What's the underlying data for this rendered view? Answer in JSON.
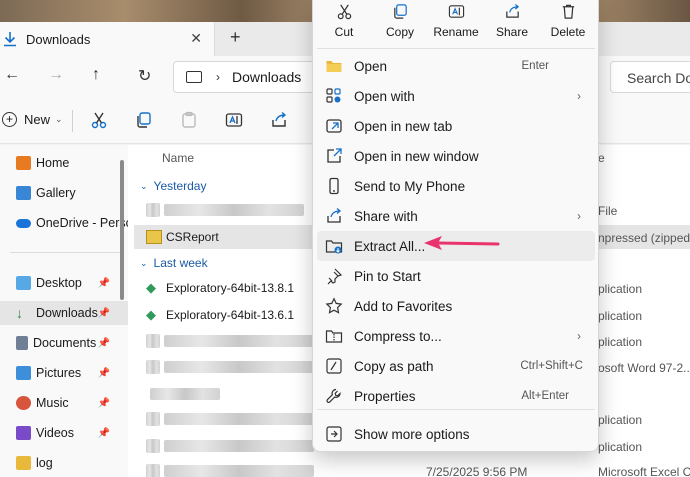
{
  "window": {
    "tab_title": "Downloads"
  },
  "address": {
    "segment": "Downloads"
  },
  "search": {
    "placeholder": "Search Dow"
  },
  "toolbar": {
    "new_label": "New"
  },
  "sidebar": {
    "items": [
      {
        "label": "Home",
        "color": "#e87b22",
        "pinned": false
      },
      {
        "label": "Gallery",
        "color": "#3a86d6",
        "pinned": false
      },
      {
        "label": "OneDrive - Perso",
        "color": "#1a73d8",
        "pinned": false
      },
      {
        "label": "Desktop",
        "color": "#57a9e6",
        "pinned": true
      },
      {
        "label": "Downloads",
        "color": "#2f8a4b",
        "pinned": true
      },
      {
        "label": "Documents",
        "color": "#6f7f95",
        "pinned": true
      },
      {
        "label": "Pictures",
        "color": "#3d8fd9",
        "pinned": true
      },
      {
        "label": "Music",
        "color": "#d8553d",
        "pinned": true
      },
      {
        "label": "Videos",
        "color": "#7a4bc8",
        "pinned": true
      },
      {
        "label": "log",
        "color": "#e8b93a",
        "pinned": false
      }
    ]
  },
  "content": {
    "column_name": "Name",
    "group_yesterday": "Yesterday",
    "group_last_week": "Last week",
    "files": {
      "csreport": "CSReport",
      "exploratory1": "Exploratory-64bit-13.8.1",
      "exploratory2": "Exploratory-64bit-13.6.1"
    },
    "type_col": {
      "r1": "File",
      "r2": "npressed (zipped)...",
      "r3": "plication",
      "r4": "plication",
      "r5": "plication",
      "r6": "osoft Word 97-2...",
      "r7": "plication",
      "r8": "plication",
      "r9": "Microsoft Excel CSV ..."
    },
    "last_date": "7/25/2025 9:56 PM",
    "header_partial": "e"
  },
  "context_menu": {
    "quick_actions": [
      "Cut",
      "Copy",
      "Rename",
      "Share",
      "Delete"
    ],
    "items": [
      {
        "label": "Open",
        "accel": "Enter",
        "submenu": false,
        "icon": "folder-icon"
      },
      {
        "label": "Open with",
        "accel": "",
        "submenu": true,
        "icon": "open-with-icon"
      },
      {
        "label": "Open in new tab",
        "accel": "",
        "submenu": false,
        "icon": "new-tab-icon"
      },
      {
        "label": "Open in new window",
        "accel": "",
        "submenu": false,
        "icon": "new-window-icon"
      },
      {
        "label": "Send to My Phone",
        "accel": "",
        "submenu": false,
        "icon": "phone-icon"
      },
      {
        "label": "Share with",
        "accel": "",
        "submenu": true,
        "icon": "share-with-icon"
      },
      {
        "label": "Extract All...",
        "accel": "",
        "submenu": false,
        "icon": "extract-icon"
      },
      {
        "label": "Pin to Start",
        "accel": "",
        "submenu": false,
        "icon": "pin-icon"
      },
      {
        "label": "Add to Favorites",
        "accel": "",
        "submenu": false,
        "icon": "star-icon"
      },
      {
        "label": "Compress to...",
        "accel": "",
        "submenu": true,
        "icon": "compress-icon"
      },
      {
        "label": "Copy as path",
        "accel": "Ctrl+Shift+C",
        "submenu": false,
        "icon": "copy-path-icon"
      },
      {
        "label": "Properties",
        "accel": "Alt+Enter",
        "submenu": false,
        "icon": "properties-icon"
      },
      {
        "label": "Show more options",
        "accel": "",
        "submenu": false,
        "icon": "more-options-icon"
      }
    ]
  },
  "colors": {
    "accent": "#1670c9",
    "arrow": "#e8336d"
  }
}
